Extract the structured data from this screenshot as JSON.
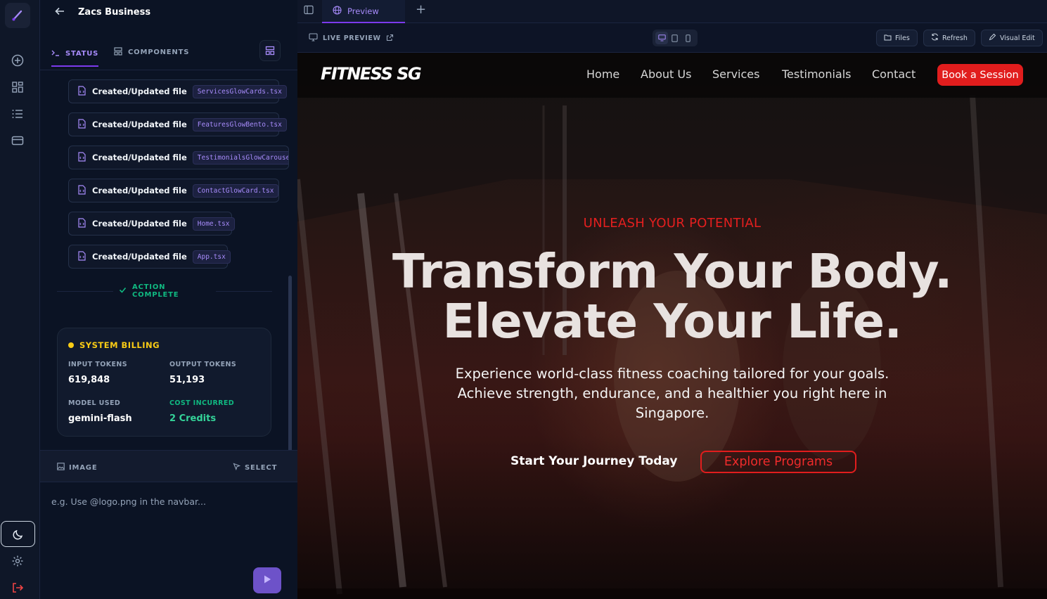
{
  "sidebar": {
    "icons": [
      "brush-logo-icon",
      "plus-circle-icon",
      "grid-icon",
      "list-icon",
      "card-icon",
      "moon-icon",
      "gear-icon",
      "logout-icon"
    ]
  },
  "panel": {
    "title": "Zacs Business",
    "tabs": {
      "status": "STATUS",
      "components": "COMPONENTS"
    },
    "files": [
      {
        "label": "Created/Updated file",
        "file": "ServicesGlowCards.tsx"
      },
      {
        "label": "Created/Updated file",
        "file": "FeaturesGlowBento.tsx"
      },
      {
        "label": "Created/Updated file",
        "file": "TestimonialsGlowCarousel."
      },
      {
        "label": "Created/Updated file",
        "file": "ContactGlowCard.tsx"
      },
      {
        "label": "Created/Updated file",
        "file": "Home.tsx"
      },
      {
        "label": "Created/Updated file",
        "file": "App.tsx"
      }
    ],
    "action_complete": "ACTION COMPLETE",
    "billing": {
      "title": "SYSTEM BILLING",
      "input_tokens_label": "INPUT TOKENS",
      "input_tokens": "619,848",
      "output_tokens_label": "OUTPUT TOKENS",
      "output_tokens": "51,193",
      "model_label": "MODEL USED",
      "model": "gemini-flash",
      "cost_label": "COST INCURRED",
      "cost": "2 Credits"
    },
    "toolbar": {
      "image": "IMAGE",
      "select": "SELECT"
    },
    "prompt_placeholder": "e.g. Use @logo.png in the navbar..."
  },
  "preview": {
    "tab_label": "Preview",
    "live_preview": "LIVE PREVIEW",
    "actions": {
      "files": "Files",
      "refresh": "Refresh",
      "visual_edit": "Visual Edit"
    }
  },
  "site": {
    "brand": "FITNESS SG",
    "nav": [
      "Home",
      "About Us",
      "Services",
      "Testimonials",
      "Contact"
    ],
    "book": "Book a Session",
    "eyebrow": "UNLEASH YOUR POTENTIAL",
    "headline_1": "Transform Your Body.",
    "headline_2": "Elevate Your Life.",
    "subtext": "Experience world-class fitness coaching tailored for your goals. Achieve strength, endurance, and a healthier you right here in Singapore.",
    "cta_primary": "Start Your Journey Today",
    "cta_secondary": "Explore Programs"
  },
  "colors": {
    "accent": "#7c3aed",
    "brand_red": "#e11d1d",
    "billing_yellow": "#facc15",
    "success": "#10b981"
  }
}
